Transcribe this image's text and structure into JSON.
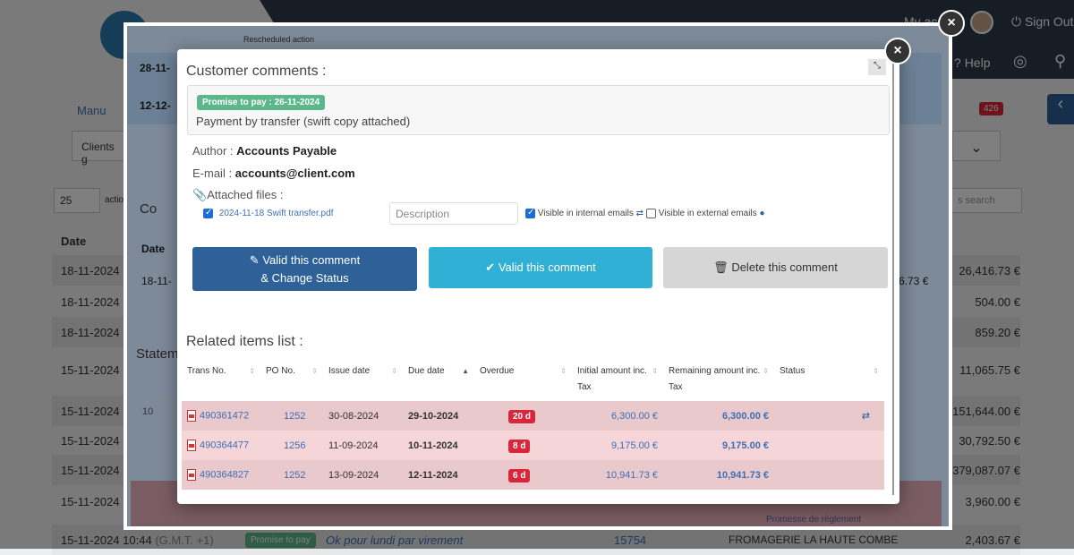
{
  "background": {
    "header": {
      "my_account": "My acc",
      "sign_out": "Sign Out",
      "help": "Help",
      "notification_count": "426"
    },
    "manual": "Manu",
    "clients_filter": "Clients g",
    "per_page": "25",
    "actions": "actio",
    "search_placeholder": "s search",
    "date_header": "Date",
    "rows": [
      {
        "date": "18-11-2024 1",
        "amount": "26,416.73 €"
      },
      {
        "date": "18-11-2024 1",
        "amount": "504.00 €"
      },
      {
        "date": "18-11-2024 1",
        "amount": "859.20 €"
      },
      {
        "date": "15-11-2024 1",
        "amount": "11,065.75 €"
      },
      {
        "date": "15-11-2024 1",
        "amount": "151,644.00 €"
      },
      {
        "date": "15-11-2024 1",
        "amount": "30,792.50 €"
      },
      {
        "date": "15-11-2024 1",
        "amount": "379,087.07 €"
      },
      {
        "date": "15-11-2024 1",
        "amount": "3,960.00 €"
      }
    ],
    "last_row": {
      "date": "15-11-2024 10:44",
      "tz": "(G.M.T. +1)",
      "badge": "Promise to pay",
      "comment": "Ok pour lundi par virement",
      "ref": "15754",
      "client": "FROMAGERIE LA HAUTE COMBE",
      "amount": "2,403.67 €"
    }
  },
  "outer_modal": {
    "rescheduled": "Rescheduled action",
    "rows": [
      "28-11-",
      "12-12-"
    ],
    "comments_title": "Co",
    "date": "Date",
    "row_date": "18-11-",
    "row_amount": "6.73 €",
    "statement": "Statem",
    "per_page": "10",
    "promise_text": "Promesse de règlement"
  },
  "modal": {
    "title": "Customer comments :",
    "promise_badge": "Promise to pay : 26-11-2024",
    "comment": "Payment by transfer (swift copy attached)",
    "author_label": "Author :",
    "author": "Accounts Payable",
    "email_label": "E-mail :",
    "email": "accounts@client.com",
    "attached_label": "Attached files :",
    "file": {
      "name": "2024-11-18 Swift transfer.pdf",
      "checked": true
    },
    "description_placeholder": "Description",
    "visible_internal": {
      "label": "Visible in internal emails",
      "checked": true
    },
    "visible_external": {
      "label": "Visible in external emails",
      "checked": false
    },
    "buttons": {
      "valid_change_1": "Valid this comment",
      "valid_change_2": "& Change Status",
      "valid": "Valid this comment",
      "delete": "Delete this comment"
    },
    "colors": {
      "primary": "#2d6197",
      "info": "#31b0d5",
      "default": "#d6d6d6",
      "overdue": "#d9263a",
      "promise": "#5cb88a"
    },
    "related_title": "Related items list :",
    "columns": [
      "Trans No.",
      "PO No.",
      "Issue date",
      "Due date",
      "Overdue",
      "Initial amount inc. Tax",
      "Remaining amount inc. Tax",
      "Status"
    ],
    "items": [
      {
        "trans": "490361472",
        "po": "1252",
        "issue": "30-08-2024",
        "due": "29-10-2024",
        "overdue": "20 d",
        "initial": "6,300.00 €",
        "remaining": "6,300.00 €",
        "status_icon": "exchange-icon"
      },
      {
        "trans": "490364477",
        "po": "1256",
        "issue": "11-09-2024",
        "due": "10-11-2024",
        "overdue": "8 d",
        "initial": "9,175.00 €",
        "remaining": "9,175.00 €"
      },
      {
        "trans": "490364827",
        "po": "1252",
        "issue": "13-09-2024",
        "due": "12-11-2024",
        "overdue": "6 d",
        "initial": "10,941.73 €",
        "remaining": "10,941.73 €"
      }
    ]
  }
}
